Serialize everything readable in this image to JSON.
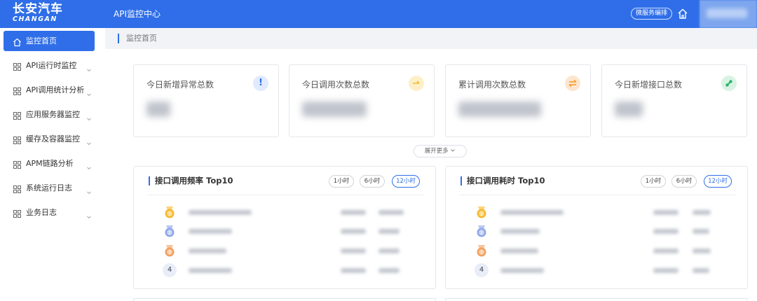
{
  "header": {
    "logo_cn": "长安汽车",
    "logo_en": "CHANGAN",
    "app_title": "API监控中心",
    "service_button": "微服务编排"
  },
  "sidebar": {
    "items": [
      {
        "label": "监控首页",
        "icon": "home-icon",
        "active": true
      },
      {
        "label": "API运行时监控",
        "icon": "grid-icon"
      },
      {
        "label": "API调用统计分析",
        "icon": "grid-icon"
      },
      {
        "label": "应用服务器监控",
        "icon": "grid-icon"
      },
      {
        "label": "缓存及容器监控",
        "icon": "grid-icon"
      },
      {
        "label": "APM链路分析",
        "icon": "grid-icon"
      },
      {
        "label": "系统运行日志",
        "icon": "grid-icon"
      },
      {
        "label": "业务日志",
        "icon": "grid-icon"
      }
    ]
  },
  "breadcrumb": "监控首页",
  "stats": [
    {
      "title": "今日新增异常总数",
      "icon": "exclamation-icon",
      "color": "#2f6ee8"
    },
    {
      "title": "今日调用次数总数",
      "icon": "arrow-right-icon",
      "color": "#f5b82e"
    },
    {
      "title": "累计调用次数总数",
      "icon": "swap-icon",
      "color": "#f59a23"
    },
    {
      "title": "今日新增接口总数",
      "icon": "link-icon",
      "color": "#2db36b"
    }
  ],
  "expand_more": "展开更多",
  "panels": [
    {
      "title": "接口调用频率 Top10",
      "ranges": [
        "1小时",
        "6小时",
        "12小时"
      ],
      "active_range": "12小时",
      "rank4_label": "4"
    },
    {
      "title": "接口调用耗时 Top10",
      "ranges": [
        "1小时",
        "6小时",
        "12小时"
      ],
      "active_range": "12小时",
      "rank4_label": "4"
    }
  ],
  "colors": {
    "primary": "#2f6ee8",
    "gold": "#f5b82e",
    "silver": "#8fa6e8",
    "bronze": "#f0a060"
  }
}
